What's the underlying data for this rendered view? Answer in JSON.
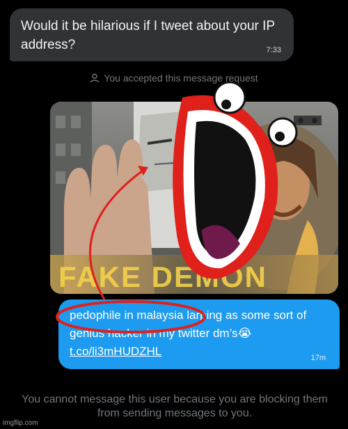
{
  "incoming": {
    "text": "Would it be hilarious if I tweet about your IP address?",
    "time": "7:33"
  },
  "notice": {
    "icon": "person-icon",
    "text": "You accepted this message request"
  },
  "media": {
    "caption": "FAKE DEMON"
  },
  "outgoing": {
    "text": "pedophile in malaysia larping as some sort of genius hacker in my twitter dm’s",
    "emoji": "😭",
    "link": "t.co/li3mHUDZHL",
    "time": "17m"
  },
  "footer": {
    "text": "You cannot message this user because you are blocking them from sending messages to you."
  },
  "watermark": "imgflip.com",
  "colors": {
    "background": "#000000",
    "incoming_bubble": "#2f3336",
    "outgoing_bubble": "#1d9bf0",
    "annotation_red": "#e0201b"
  }
}
